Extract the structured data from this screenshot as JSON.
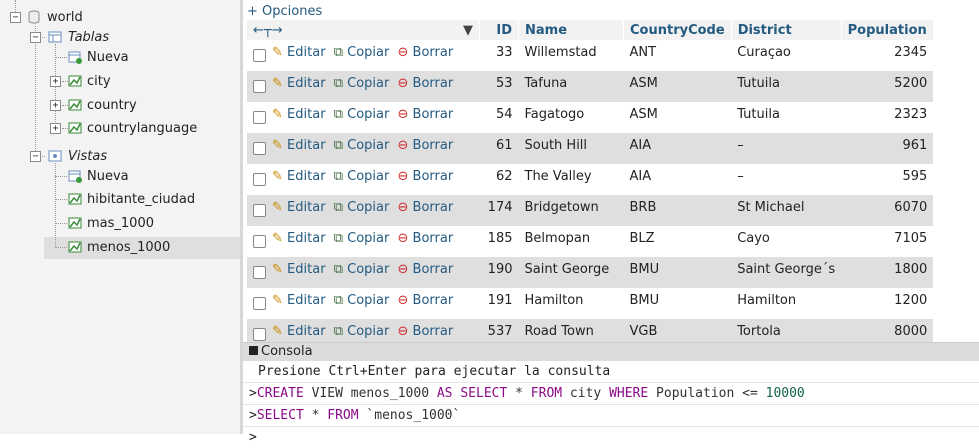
{
  "nav": {
    "db_name": "world",
    "tables_group": "Tablas",
    "tables_new": "Nueva",
    "tables": [
      "city",
      "country",
      "countrylanguage"
    ],
    "views_group": "Vistas",
    "views_new": "Nueva",
    "views": [
      "hibitante_ciudad",
      "mas_1000",
      "menos_1000"
    ],
    "selected": "menos_1000"
  },
  "main": {
    "options_link": "+ Opciones",
    "columns": [
      "ID",
      "Name",
      "CountryCode",
      "District",
      "Population"
    ],
    "actions": {
      "edit": "Editar",
      "copy": "Copiar",
      "delete": "Borrar"
    },
    "rows": [
      {
        "id": "33",
        "name": "Willemstad",
        "code": "ANT",
        "district": "Curaçao",
        "population": "2345"
      },
      {
        "id": "53",
        "name": "Tafuna",
        "code": "ASM",
        "district": "Tutuila",
        "population": "5200"
      },
      {
        "id": "54",
        "name": "Fagatogo",
        "code": "ASM",
        "district": "Tutuila",
        "population": "2323"
      },
      {
        "id": "61",
        "name": "South Hill",
        "code": "AIA",
        "district": "–",
        "population": "961"
      },
      {
        "id": "62",
        "name": "The Valley",
        "code": "AIA",
        "district": "–",
        "population": "595"
      },
      {
        "id": "174",
        "name": "Bridgetown",
        "code": "BRB",
        "district": "St Michael",
        "population": "6070"
      },
      {
        "id": "185",
        "name": "Belmopan",
        "code": "BLZ",
        "district": "Cayo",
        "population": "7105"
      },
      {
        "id": "190",
        "name": "Saint George",
        "code": "BMU",
        "district": "Saint George´s",
        "population": "1800"
      },
      {
        "id": "191",
        "name": "Hamilton",
        "code": "BMU",
        "district": "Hamilton",
        "population": "1200"
      },
      {
        "id": "537",
        "name": "Road Town",
        "code": "VGB",
        "district": "Tortola",
        "population": "8000"
      }
    ]
  },
  "console": {
    "title": "Consola",
    "hint": "Presione Ctrl+Enter para ejecutar la consulta",
    "q1": {
      "p": ">",
      "k1": "CREATE",
      "t1": " VIEW menos_1000 ",
      "k2": "AS SELECT",
      "t2": " * ",
      "k3": "FROM",
      "t3": " city ",
      "k4": "WHERE",
      "t4": " Population <= ",
      "n": "10000"
    },
    "q2": {
      "p": ">",
      "k1": "SELECT",
      "t1": " * ",
      "k2": "FROM",
      "t2": " `menos_1000`"
    },
    "prompt": ">"
  },
  "colors": {
    "link": "#235a81",
    "keyword": "#8b0a8b",
    "number": "#116644"
  }
}
